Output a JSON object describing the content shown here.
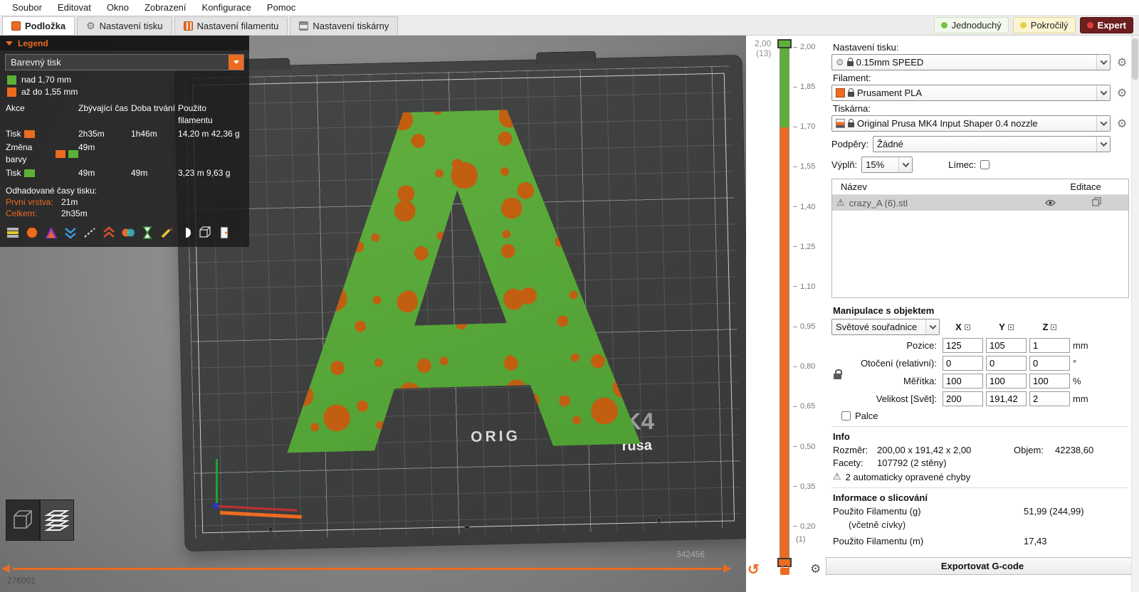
{
  "colors": {
    "accent": "#ED6B21",
    "green": "#5CB037",
    "viewport_bg": "#8a8a8a",
    "expert_bg": "#6d1f1f"
  },
  "menubar": {
    "items": [
      "Soubor",
      "Editovat",
      "Okno",
      "Zobrazení",
      "Konfigurace",
      "Pomoc"
    ]
  },
  "tabbar": {
    "tabs": [
      {
        "label": "Podložka"
      },
      {
        "label": "Nastavení tisku"
      },
      {
        "label": "Nastavení filamentu"
      },
      {
        "label": "Nastavení tiskárny"
      }
    ],
    "modes": [
      {
        "label": "Jednoduchý"
      },
      {
        "label": "Pokročilý"
      },
      {
        "label": "Expert"
      }
    ]
  },
  "legend": {
    "title": "Legend",
    "view_type": "Barevný tisk",
    "ranges": [
      {
        "label": "nad 1,70 mm"
      },
      {
        "label": "až do 1,55 mm"
      }
    ],
    "table": {
      "headers": [
        "Akce",
        "Zbývající čas",
        "Doba trvání",
        "Použito filamentu"
      ],
      "rows": [
        {
          "action": "Tisk",
          "remaining": "2h35m",
          "duration": "1h46m",
          "used": "14,20 m   42,36 g"
        },
        {
          "action": "Změna barvy",
          "remaining": "49m",
          "duration": "",
          "used": ""
        },
        {
          "action": "Tisk",
          "remaining": "49m",
          "duration": "49m",
          "used": "3,23 m    9,63 g"
        }
      ]
    },
    "estimates_title": "Odhadované časy tisku:",
    "first_layer_label": "První vrstva:",
    "first_layer_value": "21m",
    "total_label": "Celkem:",
    "total_value": "2h35m",
    "icons": [
      "extrusions",
      "color-print",
      "seams",
      "retractions",
      "travels",
      "deretractions",
      "color-changes",
      "print-time",
      "custom-gcode",
      "pause",
      "shells",
      "exit"
    ]
  },
  "viewport": {
    "letter": "A",
    "bed_text_orig": "ORIG",
    "bed_text_k4": "K4",
    "bed_text_rusa": "rusa",
    "slider_left_value": "276001",
    "slider_right_value": "342456"
  },
  "layer_slider": {
    "top_value": "2,00",
    "top_count": "(13)",
    "bottom_count": "(1)",
    "ticks": [
      "2,00",
      "1,85",
      "1,70",
      "1,55",
      "1,40",
      "1,25",
      "1,10",
      "0,95",
      "0,80",
      "0,65",
      "0,50",
      "0,35",
      "0,20"
    ]
  },
  "sidebar": {
    "print_settings_label": "Nastavení tisku:",
    "print_settings_value": "0.15mm SPEED",
    "filament_label": "Filament:",
    "filament_value": "Prusament PLA",
    "printer_label": "Tiskárna:",
    "printer_value": "Original Prusa MK4 Input Shaper 0.4 nozzle",
    "supports_label": "Podpěry:",
    "supports_value": "Žádné",
    "infill_label": "Výplň:",
    "infill_value": "15%",
    "brim_label": "Límec:",
    "object_list": {
      "name_header": "Název",
      "edit_header": "Editace",
      "row_name": "crazy_A (6).stl"
    },
    "manipulation": {
      "title": "Manipulace s objektem",
      "coord_system": "Světové souřadnice",
      "axis_x": "X",
      "axis_y": "Y",
      "axis_z": "Z",
      "rows": [
        {
          "label": "Pozice:",
          "x": "125",
          "y": "105",
          "z": "1",
          "unit": "mm"
        },
        {
          "label": "Otočení (relativní):",
          "x": "0",
          "y": "0",
          "z": "0",
          "unit": "°"
        },
        {
          "label": "Měřítka:",
          "x": "100",
          "y": "100",
          "z": "100",
          "unit": "%"
        },
        {
          "label": "Velikost [Svět]:",
          "x": "200",
          "y": "191,42",
          "z": "2",
          "unit": "mm"
        }
      ],
      "inches_label": "Palce"
    },
    "info": {
      "title": "Info",
      "size_label": "Rozměr:",
      "size_value": "200,00 x 191,42 x 2,00",
      "volume_label": "Objem:",
      "volume_value": "42238,60",
      "facets_label": "Facety:",
      "facets_value": "107792 (2 stěny)",
      "warning": "2 automaticky opravené chyby"
    },
    "slicing": {
      "title": "Informace o slicování",
      "used_g_label": "Použito Filamentu (g)",
      "used_g_sub": "(včetně cívky)",
      "used_g_value": "51,99 (244,99)",
      "used_m_label": "Použito Filamentu (m)",
      "used_m_value": "17,43"
    },
    "export_button": "Exportovat G-code"
  }
}
